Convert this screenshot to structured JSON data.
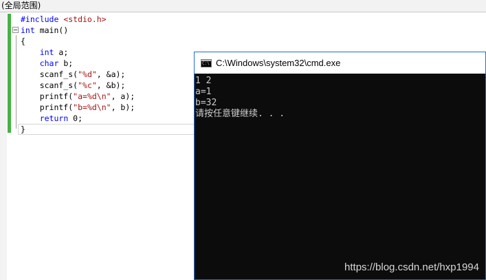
{
  "scope_bar": {
    "label": "(全局范围)"
  },
  "editor": {
    "lines": [
      {
        "parts": [
          {
            "text": "#include ",
            "cls": "pp"
          },
          {
            "text": "<stdio.h>",
            "cls": "str"
          }
        ]
      },
      {
        "parts": [
          {
            "text": "int",
            "cls": "kw"
          },
          {
            "text": " main()",
            "cls": ""
          }
        ]
      },
      {
        "parts": [
          {
            "text": "{",
            "cls": ""
          }
        ]
      },
      {
        "parts": [
          {
            "text": "    ",
            "cls": ""
          },
          {
            "text": "int",
            "cls": "kw"
          },
          {
            "text": " a;",
            "cls": ""
          }
        ]
      },
      {
        "parts": [
          {
            "text": "    ",
            "cls": ""
          },
          {
            "text": "char",
            "cls": "kw"
          },
          {
            "text": " b;",
            "cls": ""
          }
        ]
      },
      {
        "parts": [
          {
            "text": "    scanf_s(",
            "cls": ""
          },
          {
            "text": "\"%d\"",
            "cls": "str"
          },
          {
            "text": ", &a);",
            "cls": ""
          }
        ]
      },
      {
        "parts": [
          {
            "text": "    scanf_s(",
            "cls": ""
          },
          {
            "text": "\"%c\"",
            "cls": "str"
          },
          {
            "text": ", &b);",
            "cls": ""
          }
        ]
      },
      {
        "parts": [
          {
            "text": "    printf(",
            "cls": ""
          },
          {
            "text": "\"a=%d\\n\"",
            "cls": "str"
          },
          {
            "text": ", a);",
            "cls": ""
          }
        ]
      },
      {
        "parts": [
          {
            "text": "    printf(",
            "cls": ""
          },
          {
            "text": "\"b=%d\\n\"",
            "cls": "str"
          },
          {
            "text": ", b);",
            "cls": ""
          }
        ]
      },
      {
        "parts": [
          {
            "text": "    ",
            "cls": ""
          },
          {
            "text": "return",
            "cls": "kw"
          },
          {
            "text": " 0;",
            "cls": ""
          }
        ]
      },
      {
        "parts": [
          {
            "text": "}",
            "cls": ""
          }
        ]
      }
    ]
  },
  "cmd": {
    "title": "C:\\Windows\\system32\\cmd.exe",
    "icon": "cmd-icon",
    "icon_text": "C:\\",
    "output": [
      "1 2",
      "a=1",
      "b=32",
      "请按任意键继续. . ."
    ]
  },
  "watermark": "https://blog.csdn.net/hxp1994"
}
